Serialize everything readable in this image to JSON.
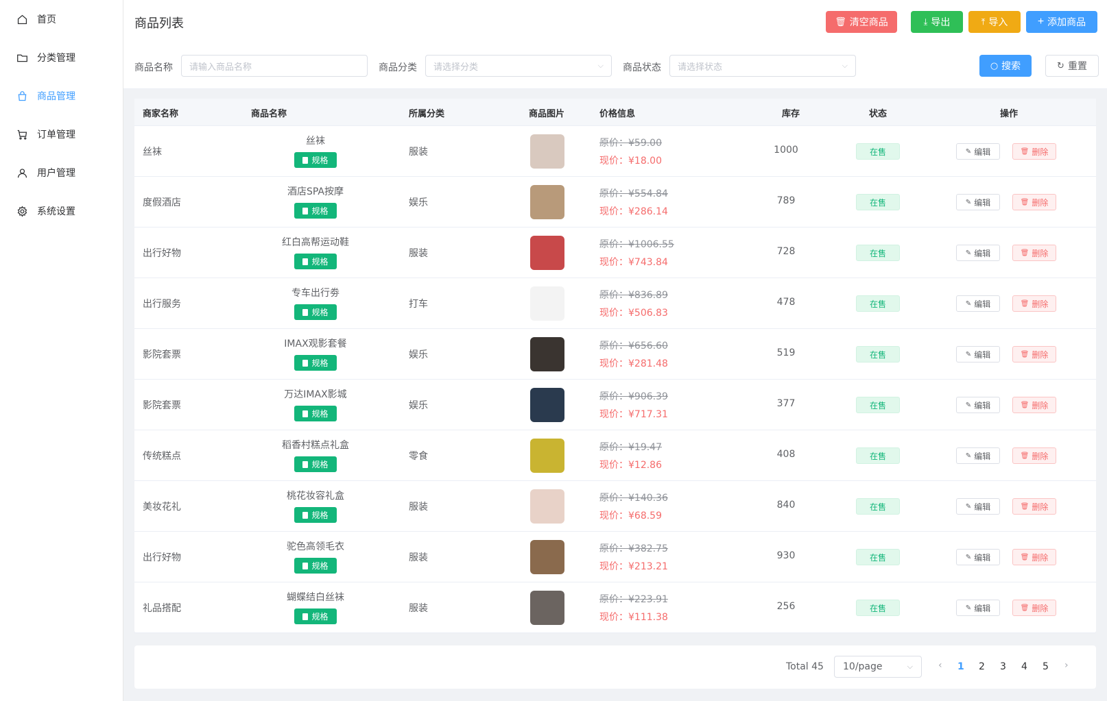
{
  "sidebar": {
    "items": [
      {
        "label": "首页",
        "icon": "home-icon"
      },
      {
        "label": "分类管理",
        "icon": "folder-icon"
      },
      {
        "label": "商品管理",
        "icon": "shopping-bag-icon",
        "active": true
      },
      {
        "label": "订单管理",
        "icon": "cart-icon"
      },
      {
        "label": "用户管理",
        "icon": "user-icon"
      },
      {
        "label": "系统设置",
        "icon": "gear-icon"
      }
    ]
  },
  "header": {
    "title": "商品列表",
    "buttons": {
      "clear": "清空商品",
      "export": "导出",
      "import": "导入",
      "add": "添加商品"
    }
  },
  "filters": {
    "name_label": "商品名称",
    "name_placeholder": "请输入商品名称",
    "category_label": "商品分类",
    "category_placeholder": "请选择分类",
    "status_label": "商品状态",
    "status_placeholder": "请选择状态",
    "search": "搜索",
    "reset": "重置"
  },
  "table": {
    "columns": [
      "商家名称",
      "商品名称",
      "所属分类",
      "商品图片",
      "价格信息",
      "库存",
      "状态",
      "操作"
    ],
    "spec_label": "规格",
    "edit_label": "编辑",
    "delete_label": "删除",
    "rows": [
      {
        "merchant": "丝袜",
        "name": "丝袜",
        "category": "服装",
        "orig": "原价：¥59.00",
        "now": "现价：¥18.00",
        "stock": "1000",
        "status": "在售",
        "img": "#d9c9bf"
      },
      {
        "merchant": "度假酒店",
        "name": "酒店SPA按摩",
        "category": "娱乐",
        "orig": "原价：¥554.84",
        "now": "现价：¥286.14",
        "stock": "789",
        "status": "在售",
        "img": "#b89a7a"
      },
      {
        "merchant": "出行好物",
        "name": "红白高帮运动鞋",
        "category": "服装",
        "orig": "原价：¥1006.55",
        "now": "现价：¥743.84",
        "stock": "728",
        "status": "在售",
        "img": "#c8494a"
      },
      {
        "merchant": "出行服务",
        "name": "专车出行劵",
        "category": "打车",
        "orig": "原价：¥836.89",
        "now": "现价：¥506.83",
        "stock": "478",
        "status": "在售",
        "img": "#f3f3f3"
      },
      {
        "merchant": "影院套票",
        "name": "IMAX观影套餐",
        "category": "娱乐",
        "orig": "原价：¥656.60",
        "now": "现价：¥281.48",
        "stock": "519",
        "status": "在售",
        "img": "#3a3430"
      },
      {
        "merchant": "影院套票",
        "name": "万达IMAX影城",
        "category": "娱乐",
        "orig": "原价：¥906.39",
        "now": "现价：¥717.31",
        "stock": "377",
        "status": "在售",
        "img": "#2a3a4e"
      },
      {
        "merchant": "传统糕点",
        "name": "稻香村糕点礼盒",
        "category": "零食",
        "orig": "原价：¥19.47",
        "now": "现价：¥12.86",
        "stock": "408",
        "status": "在售",
        "img": "#c9b431"
      },
      {
        "merchant": "美妆花礼",
        "name": "桃花妆容礼盒",
        "category": "服装",
        "orig": "原价：¥140.36",
        "now": "现价：¥68.59",
        "stock": "840",
        "status": "在售",
        "img": "#e8d2c8"
      },
      {
        "merchant": "出行好物",
        "name": "驼色高领毛衣",
        "category": "服装",
        "orig": "原价：¥382.75",
        "now": "现价：¥213.21",
        "stock": "930",
        "status": "在售",
        "img": "#8a6a4d"
      },
      {
        "merchant": "礼品搭配",
        "name": "蝴蝶结白丝袜",
        "category": "服装",
        "orig": "原价：¥223.91",
        "now": "现价：¥111.38",
        "stock": "256",
        "status": "在售",
        "img": "#6b6460"
      }
    ]
  },
  "pagination": {
    "total": "Total 45",
    "page_size": "10/page",
    "pages": [
      "1",
      "2",
      "3",
      "4",
      "5"
    ],
    "current": "1"
  }
}
